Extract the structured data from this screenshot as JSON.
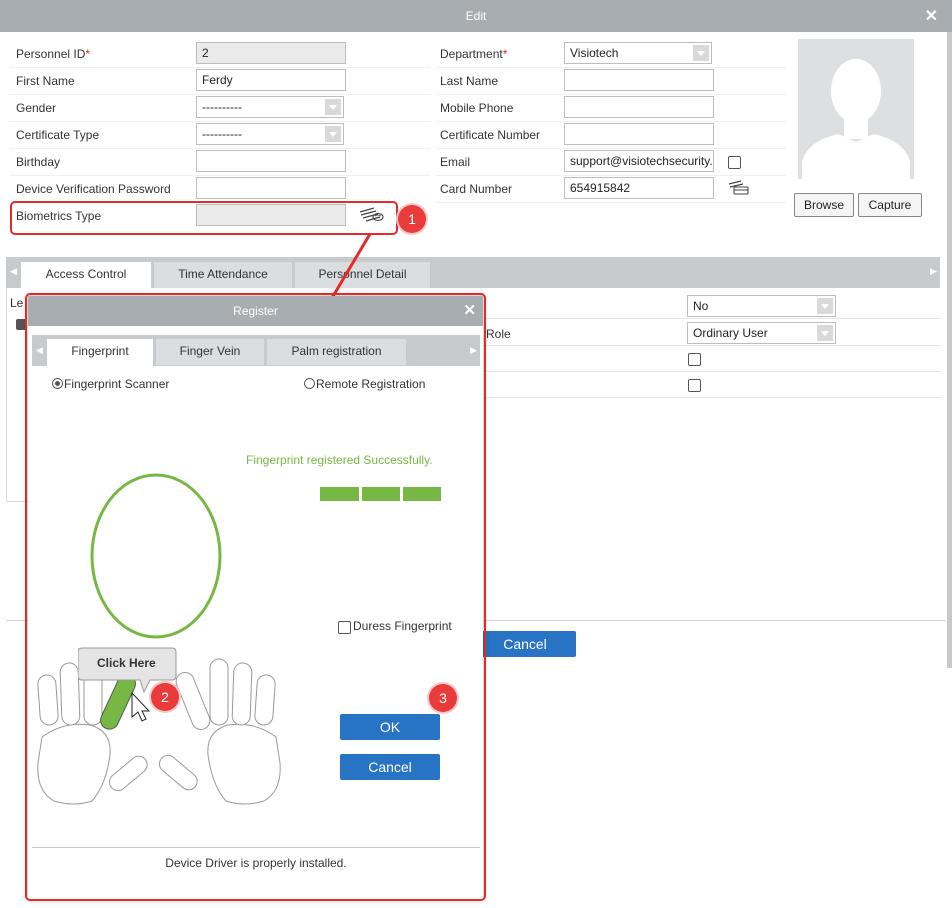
{
  "window": {
    "title": "Edit",
    "close_glyph": "✕"
  },
  "form": {
    "personnel_id_label": "Personnel ID",
    "personnel_id_value": "2",
    "first_name_label": "First Name",
    "first_name_value": "Ferdy",
    "gender_label": "Gender",
    "gender_value": "----------",
    "certificate_type_label": "Certificate Type",
    "certificate_type_value": "----------",
    "birthday_label": "Birthday",
    "birthday_value": "",
    "device_password_label": "Device Verification Password",
    "device_password_value": "",
    "biometrics_type_label": "Biometrics Type",
    "department_label": "Department",
    "department_value": "Visiotech",
    "last_name_label": "Last Name",
    "last_name_value": "",
    "mobile_phone_label": "Mobile Phone",
    "mobile_phone_value": "",
    "certificate_number_label": "Certificate Number",
    "certificate_number_value": "",
    "email_label": "Email",
    "email_value": "support@visiotechsecurity.",
    "card_number_label": "Card Number",
    "card_number_value": "654915842",
    "required_mark": "*"
  },
  "photo": {
    "browse_label": "Browse",
    "capture_label": "Capture"
  },
  "tabs": [
    {
      "label": "Access Control",
      "active": true
    },
    {
      "label": "Time Attendance",
      "active": false
    },
    {
      "label": "Personnel Detail",
      "active": false
    }
  ],
  "access_control": {
    "left_label_fragment": "Le",
    "role_label_fragment": "Role",
    "superuser_value": "No",
    "role_value": "Ordinary User",
    "cancel_label": "Cancel"
  },
  "register_dialog": {
    "title": "Register",
    "tabs": [
      {
        "label": "Fingerprint",
        "active": true
      },
      {
        "label": "Finger Vein",
        "active": false
      },
      {
        "label": "Palm registration",
        "active": false
      }
    ],
    "option_scanner": "Fingerprint Scanner",
    "option_remote": "Remote Registration",
    "success_message": "Fingerprint registered Successfully.",
    "progress_filled": 3,
    "progress_total": 3,
    "duress_label": "Duress Fingerprint",
    "click_here": "Click Here",
    "ok_label": "OK",
    "cancel_label": "Cancel",
    "status_text": "Device Driver is properly installed."
  },
  "annotations": {
    "badge_1": "1",
    "badge_2": "2",
    "badge_3": "3"
  },
  "colors": {
    "accent_blue": "#2773c4",
    "success_green": "#77b844",
    "annotation_red": "#e52a2a",
    "titlebar_gray": "#a8adb2"
  }
}
